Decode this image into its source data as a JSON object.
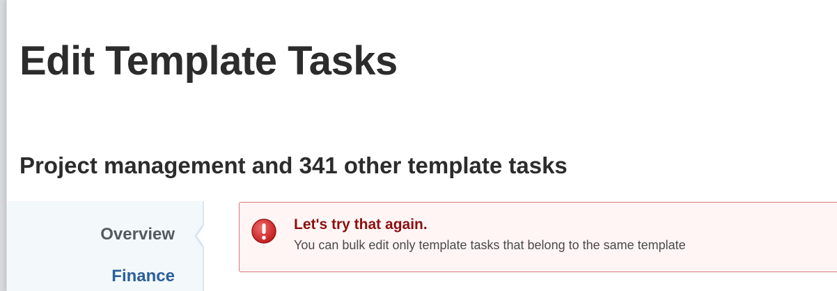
{
  "dialog": {
    "title": "Edit Template Tasks",
    "subtitle": "Project management and 341 other template tasks"
  },
  "sidebar": {
    "items": [
      {
        "label": "Overview",
        "active": true
      },
      {
        "label": "Finance",
        "active": false
      }
    ]
  },
  "alert": {
    "icon": "error-icon",
    "title": "Let's try that again.",
    "message": "You can bulk edit only template tasks that belong to the same template",
    "colors": {
      "background": "#fff5f5",
      "border": "#d9777b",
      "title": "#8b0f0f",
      "icon": "#d42a2a"
    }
  },
  "colors": {
    "link": "#2a5f9a",
    "text": "#2c2c2c"
  }
}
